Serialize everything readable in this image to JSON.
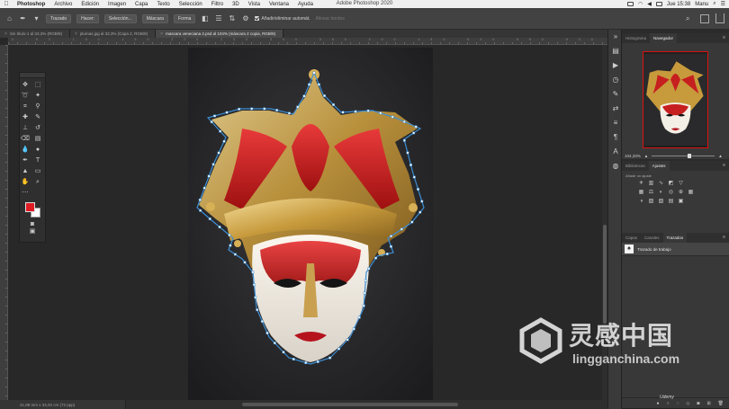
{
  "menubar": {
    "apple_icon": "",
    "items": [
      "Photoshop",
      "Archivo",
      "Edición",
      "Imagen",
      "Capa",
      "Texto",
      "Selección",
      "Filtro",
      "3D",
      "Vista",
      "Ventana",
      "Ayuda"
    ],
    "window_title": "Adobe Photoshop 2020",
    "clock": "Jue 15:38",
    "user": "Manu"
  },
  "options_bar": {
    "tool_preset": "Trazado",
    "make_label": "Hacer:",
    "selection_button": "Selección...",
    "mask_button": "Máscara",
    "shape_button": "Forma",
    "auto_add_delete": "Añadir/eliminar automát.",
    "align_edges": "Alinear bordes"
  },
  "tabs": [
    {
      "label": "Sin título-1 al 33,3% (RGB/8)",
      "active": false
    },
    {
      "label": "plumas.jpg al 33,3% (Capa 2, RGB/8)",
      "active": false
    },
    {
      "label": "mascara veneciana 2.psd al 104% (máscara 2 copia, RGB/8)",
      "active": true
    }
  ],
  "rulers": {
    "top_numbers": "0 50 100 150 200 250 300 350 400 450 500 550 600 650 700 750 800 850 900 950 1000 1050 1100 1150 1200 1250 1300 1350 1400 1450 1500 1550 1600 1650"
  },
  "status_bar": {
    "text": "21,88 mm x 34,02 cm (72 ppp)"
  },
  "navigator_panel": {
    "tabs": [
      "Histograma",
      "Navegador"
    ],
    "active_tab": "Navegador",
    "zoom": "104,33%"
  },
  "adjustments_panel": {
    "tabs": [
      "Bibliotecas",
      "Ajustes"
    ],
    "active_tab": "Ajustes",
    "hint": "Añadir un ajuste"
  },
  "layers_panel": {
    "tabs": [
      "Capas",
      "Canales",
      "Trazados"
    ],
    "active_tab": "Trazados",
    "paths": [
      {
        "name": "Trazado de trabajo"
      }
    ]
  },
  "watermark": {
    "title": "灵感中国",
    "url": "lingganchina.com"
  },
  "udemy_label": "Udemy",
  "colors": {
    "foreground": "#e01b24",
    "background": "#ffffff",
    "accent_path": "#3d8fd6"
  }
}
